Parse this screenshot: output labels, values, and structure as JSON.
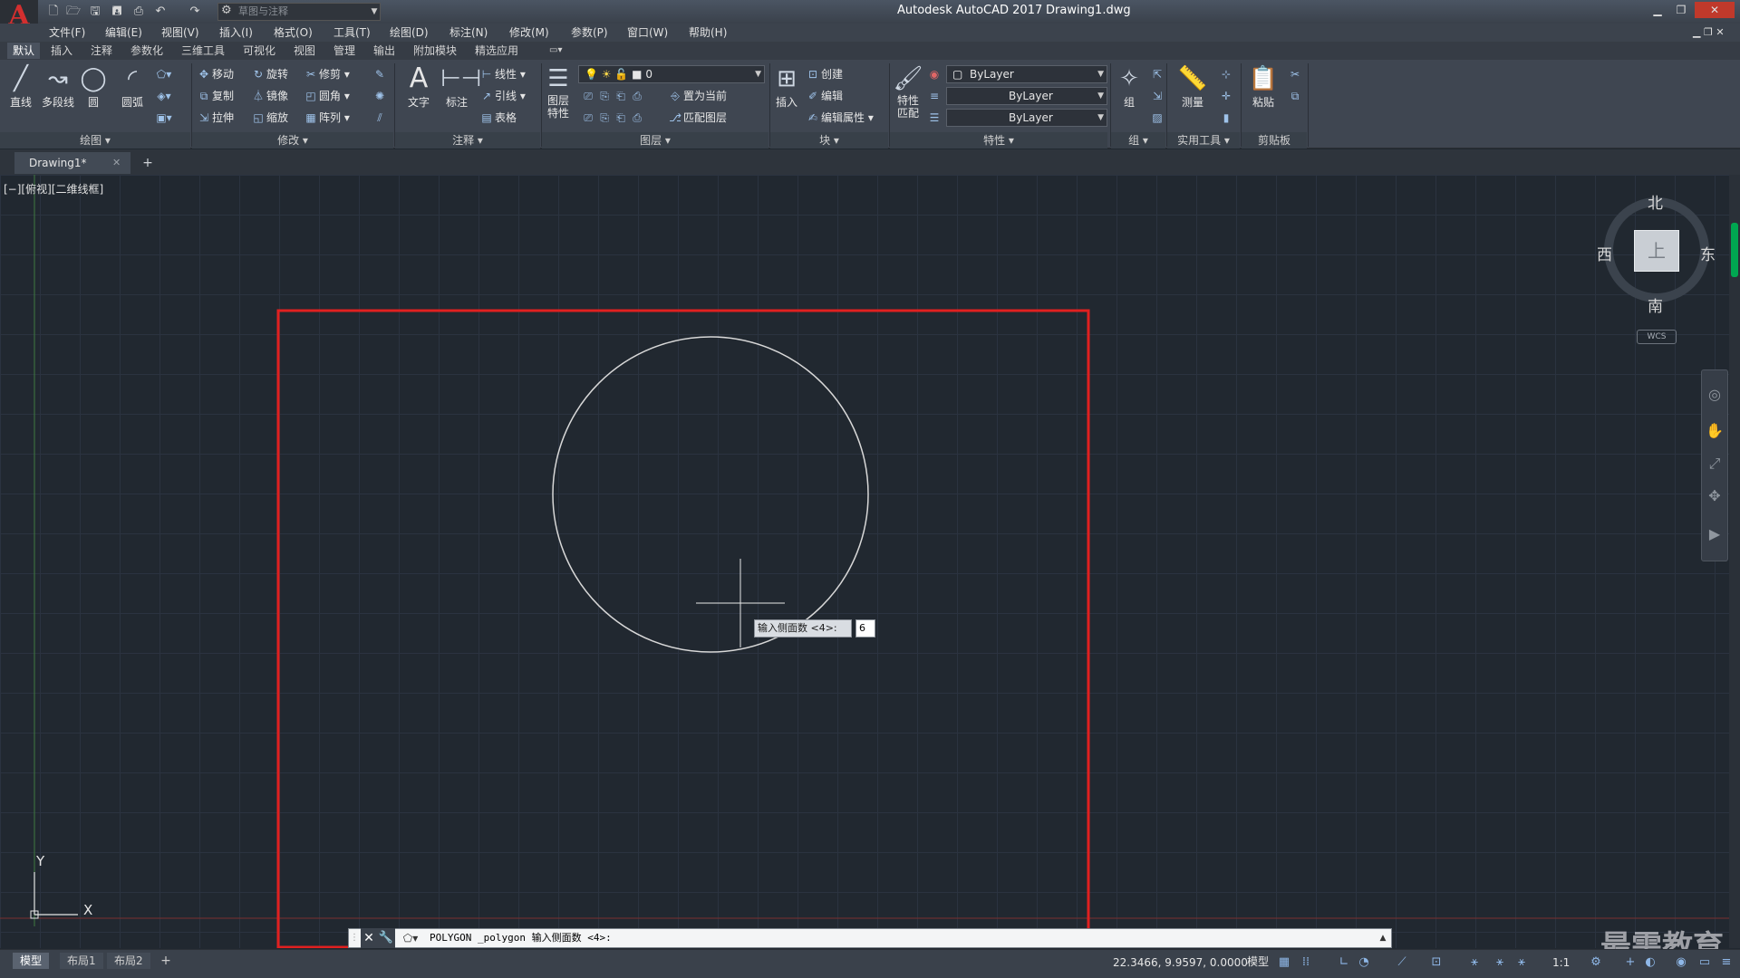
{
  "title": {
    "app": "Autodesk AutoCAD 2017",
    "file": "Drawing1.dwg"
  },
  "quick_access": {
    "workspace": "草图与注释"
  },
  "menu": [
    "文件(F)",
    "编辑(E)",
    "视图(V)",
    "插入(I)",
    "格式(O)",
    "工具(T)",
    "绘图(D)",
    "标注(N)",
    "修改(M)",
    "参数(P)",
    "窗口(W)",
    "帮助(H)"
  ],
  "ribbon_tabs": [
    "默认",
    "插入",
    "注释",
    "参数化",
    "三维工具",
    "可视化",
    "视图",
    "管理",
    "输出",
    "附加模块",
    "精选应用"
  ],
  "ribbon": {
    "draw": {
      "label": "绘图",
      "line": "直线",
      "polyline": "多段线",
      "circle": "圆",
      "arc": "圆弧"
    },
    "modify": {
      "label": "修改",
      "move": "移动",
      "rotate": "旋转",
      "trim": "修剪",
      "copy": "复制",
      "mirror": "镜像",
      "fillet": "圆角",
      "stretch": "拉伸",
      "scale": "缩放",
      "array": "阵列"
    },
    "annotation": {
      "label": "注释",
      "text": "文字",
      "dimension": "标注",
      "linear": "线性",
      "leader": "引线",
      "table": "表格"
    },
    "layers": {
      "label": "图层",
      "properties_line1": "图层",
      "properties_line2": "特性",
      "current_layer": "0",
      "set_current": "置为当前",
      "match_layer": "匹配图层"
    },
    "block": {
      "label": "块",
      "insert": "插入",
      "create": "创建",
      "edit": "编辑",
      "edit_attributes": "编辑属性"
    },
    "properties": {
      "label": "特性",
      "match_line1": "特性",
      "match_line2": "匹配",
      "color": "ByLayer",
      "linetype": "ByLayer",
      "lineweight": "ByLayer"
    },
    "groups": {
      "label": "组",
      "group": "组"
    },
    "utilities": {
      "label": "实用工具",
      "measure": "测量"
    },
    "clipboard": {
      "label": "剪贴板",
      "paste": "粘贴"
    }
  },
  "file_tabs": [
    {
      "label": "Drawing1*"
    }
  ],
  "viewport_label": "[−][俯视][二维线框]",
  "viewcube": {
    "north": "北",
    "south": "南",
    "east": "东",
    "west": "西",
    "top": "上",
    "wcs": "WCS"
  },
  "ucs": {
    "x": "X",
    "y": "Y"
  },
  "dynamic_input": {
    "prompt": "输入侧面数 <4>:",
    "value": "6"
  },
  "command_line": {
    "text": "POLYGON _polygon 输入侧面数 <4>:"
  },
  "status": {
    "layout_tabs": [
      "模型",
      "布局1",
      "布局2"
    ],
    "coordinates": "22.3466, 9.9597, 0.0000",
    "model": "模型",
    "scale": "1:1"
  },
  "watermark": "最需教育",
  "colors": {
    "highlight_box": "#e02020",
    "circle": "#d8d8d8",
    "canvas_bg": "#212830",
    "logo": "#d32f2f"
  }
}
